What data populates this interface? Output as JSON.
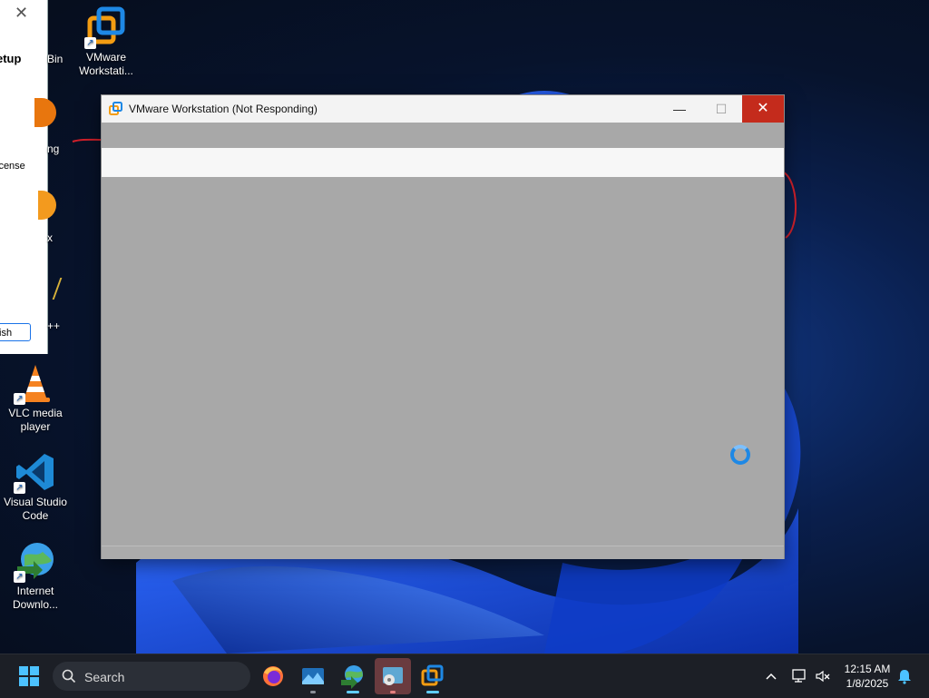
{
  "desktop": {
    "icons": [
      {
        "label": "VMware Workstati...",
        "icon": "vmware-icon"
      },
      {
        "label": "VLC media player",
        "icon": "vlc-cone-icon"
      },
      {
        "label": "Visual Studio Code",
        "icon": "vscode-icon"
      },
      {
        "label": "Internet Downlo...",
        "icon": "idm-globe-icon"
      }
    ],
    "partial_labels": {
      "recycle": "Bin",
      "app2": "ng",
      "app3": "x",
      "app4": "++"
    }
  },
  "setup_window": {
    "title": "etup",
    "license_text": "icense",
    "finish_label": "ish"
  },
  "vmware_window": {
    "title": "VMware Workstation (Not Responding)",
    "state": "not-responding",
    "controls": {
      "minimize": "minimize-icon",
      "maximize": "maximize-icon",
      "close": "close-icon"
    }
  },
  "taskbar": {
    "search_placeholder": "Search",
    "apps": [
      "windows-start-icon",
      "firefox-icon",
      "photos-icon",
      "idm-icon",
      "disk-tool-icon",
      "vmware-icon"
    ],
    "time": "12:15 AM",
    "date": "1/8/2025"
  },
  "colors": {
    "close_red": "#c42b1c",
    "accent_blue": "#60cdff",
    "annotation_red": "#d0202a"
  }
}
